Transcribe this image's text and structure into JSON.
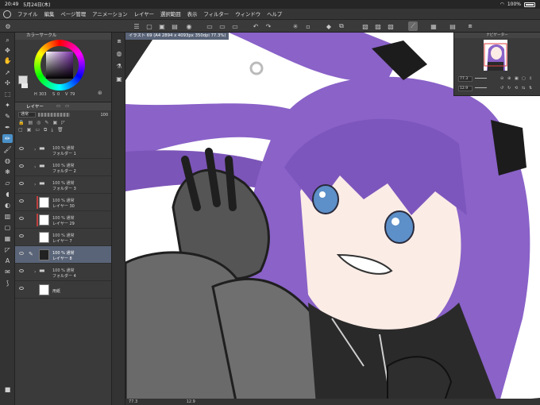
{
  "status_bar": {
    "time": "20:49",
    "date": "5月24日(木)",
    "battery": "100%"
  },
  "menu": {
    "items": [
      "ファイル",
      "編集",
      "ページ管理",
      "アニメーション",
      "レイヤー",
      "選択範囲",
      "表示",
      "フィルター",
      "ウィンドウ",
      "ヘルプ"
    ]
  },
  "color_panel": {
    "title": "カラーサークル",
    "value_h": "303",
    "value_s": "0",
    "value_v": "79"
  },
  "layer_panel": {
    "tabs": [
      "レイヤー"
    ],
    "blend_mode": "通常",
    "opacity": "100",
    "layers": [
      {
        "opacity_mode": "100 % 通常",
        "name": "フォルダー 1",
        "kind": "folder"
      },
      {
        "opacity_mode": "100 % 通常",
        "name": "フォルダー 2",
        "kind": "folder"
      },
      {
        "opacity_mode": "100 % 通常",
        "name": "フォルダー 3",
        "kind": "folder"
      },
      {
        "opacity_mode": "100 % 通常",
        "name": "レイヤー 30",
        "kind": "layer"
      },
      {
        "opacity_mode": "100 % 通常",
        "name": "レイヤー 29",
        "kind": "layer"
      },
      {
        "opacity_mode": "100 % 通常",
        "name": "レイヤー 7",
        "kind": "layer"
      },
      {
        "opacity_mode": "100 % 通常",
        "name": "レイヤー 8",
        "kind": "layer",
        "selected": true
      },
      {
        "opacity_mode": "100 % 通常",
        "name": "フォルダー 4",
        "kind": "folder"
      },
      {
        "opacity_mode": "",
        "name": "用紙",
        "kind": "paper"
      }
    ]
  },
  "canvas": {
    "doc_tab": "イラスト 69 (A4 2894 x 4093px 350dpi 77.3%)",
    "status_zoom": "77.3",
    "status_rotate": "12.9"
  },
  "navigator": {
    "title": "ナビゲーター",
    "zoom": "77.3",
    "angle": "12.9"
  },
  "colors": {
    "accent": "#4a90c8",
    "selected_layer": "#5a6478",
    "hair": "#8a62c8"
  }
}
